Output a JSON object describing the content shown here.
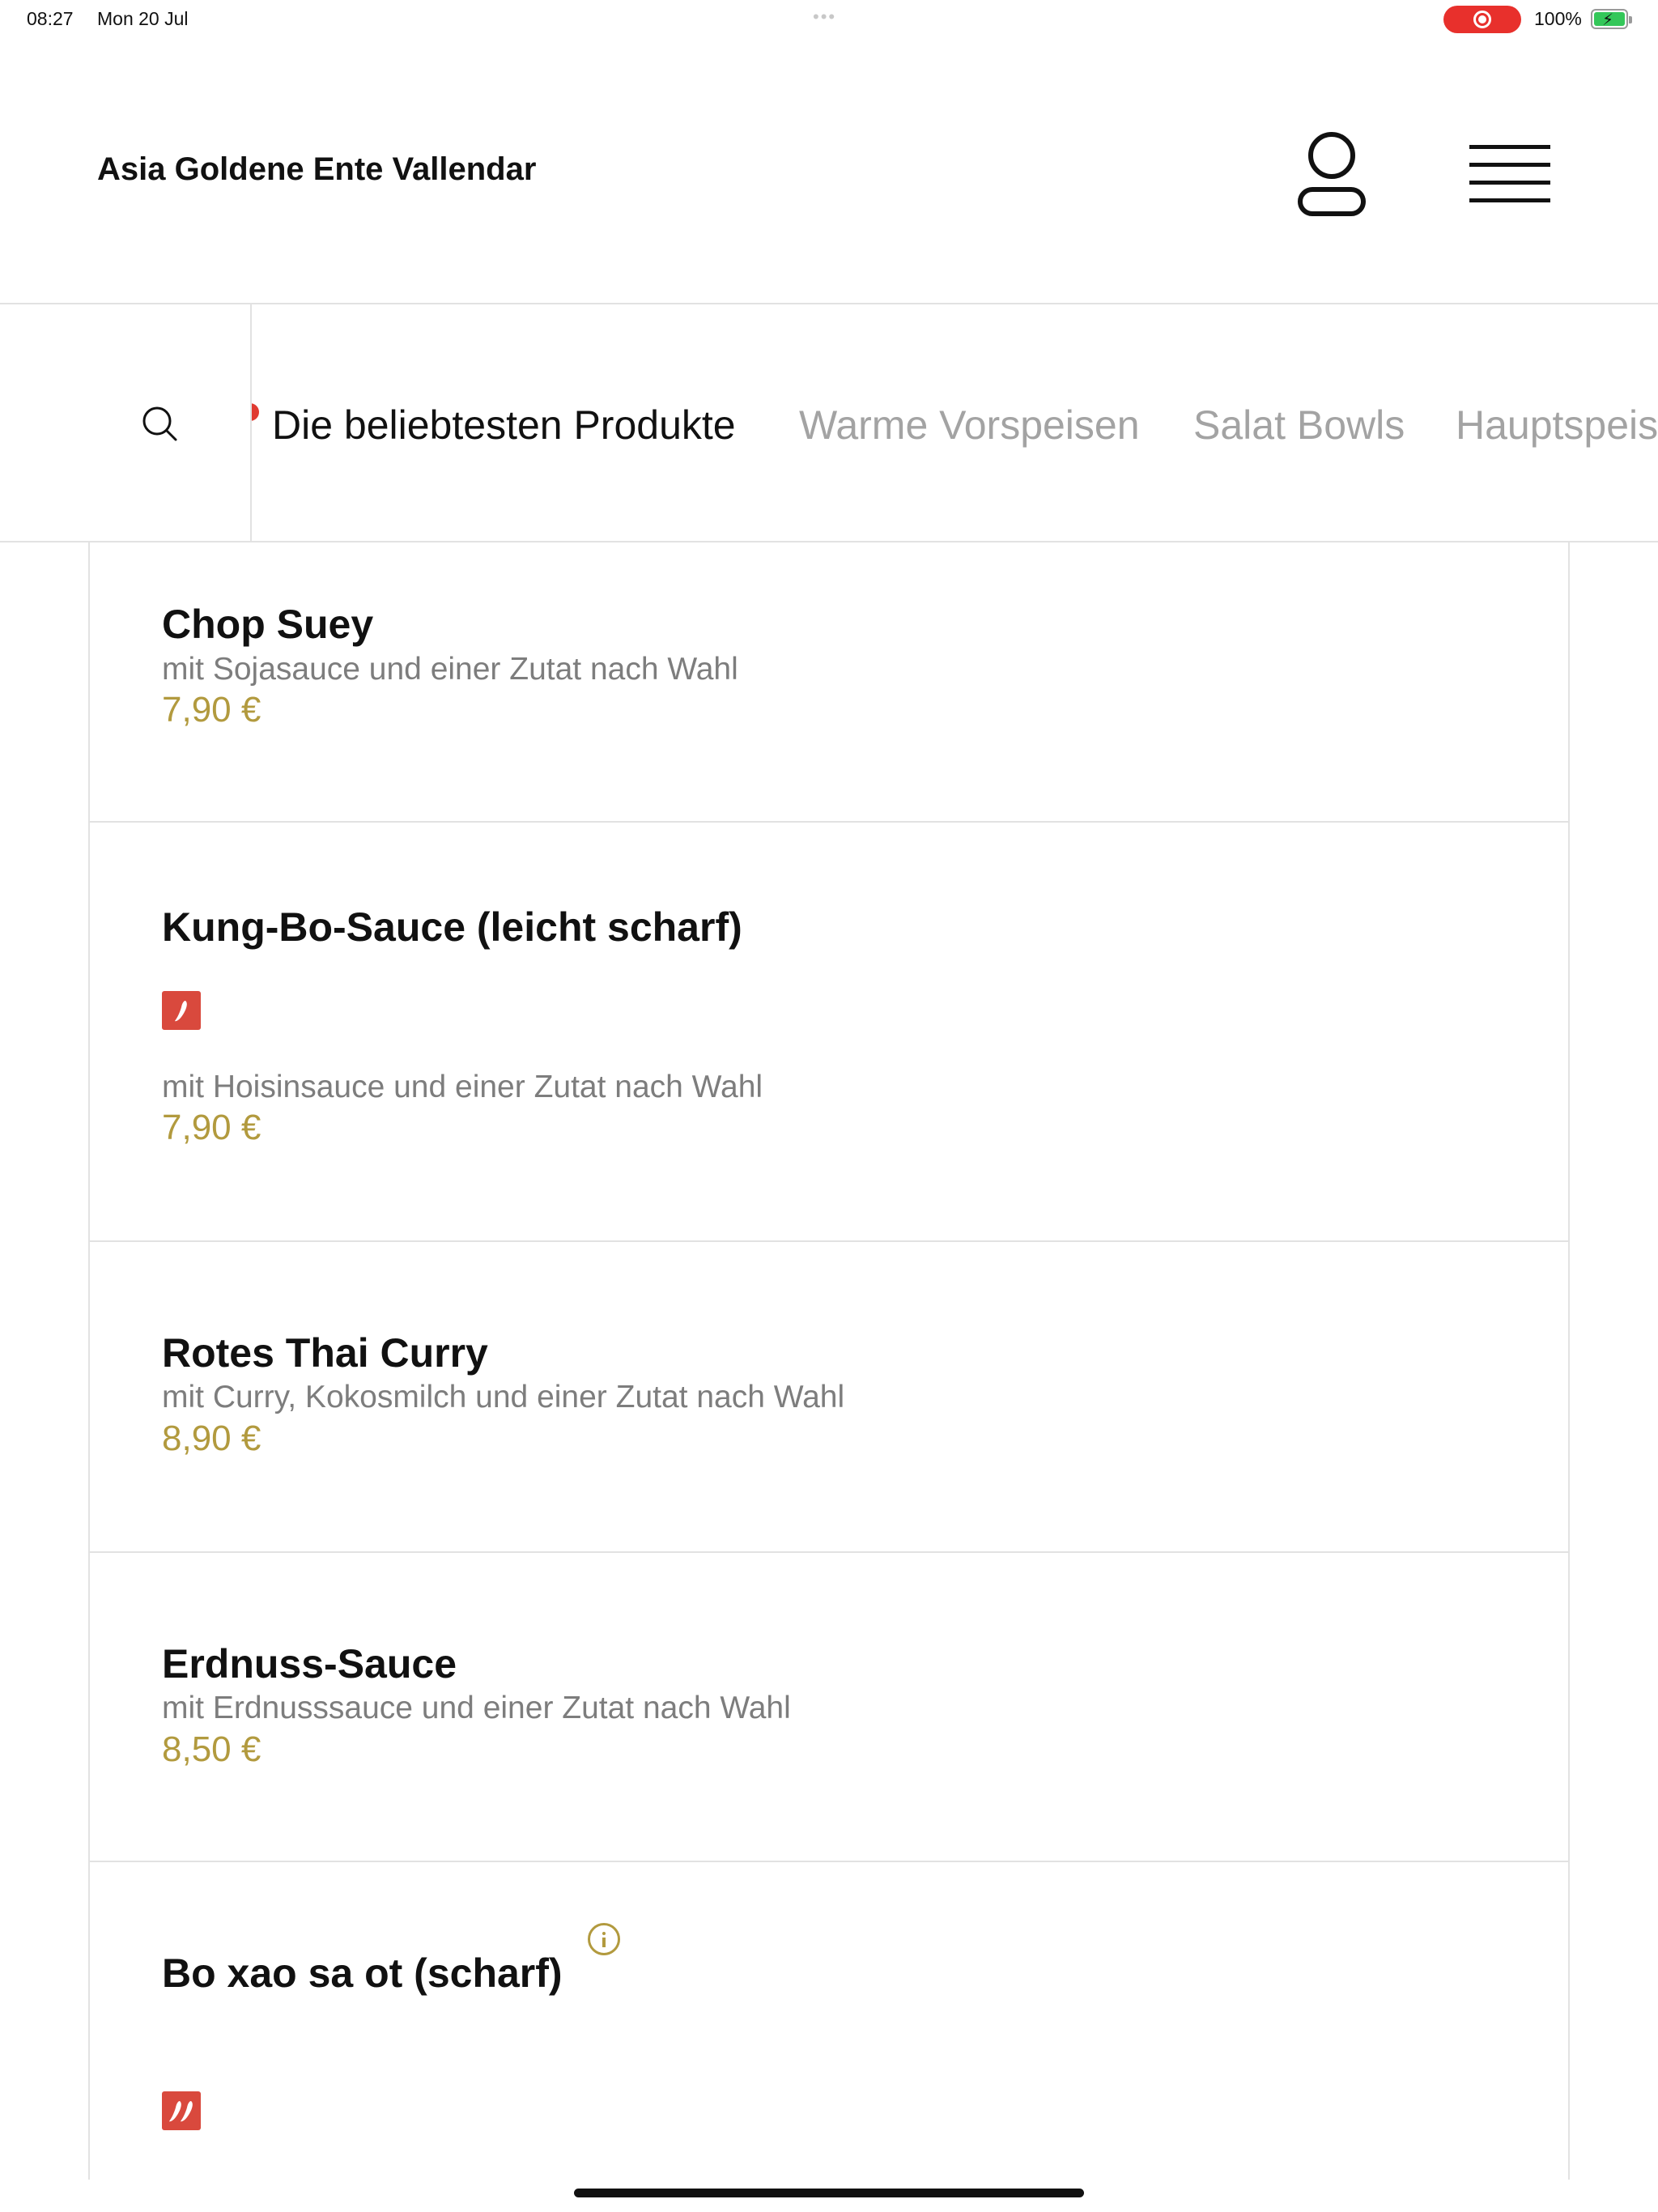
{
  "status_bar": {
    "time": "08:27",
    "date": "Mon 20 Jul",
    "battery_percent": "100%",
    "battery_level": 1.0,
    "recording_active": true
  },
  "header": {
    "restaurant_name": "Asia Goldene Ente Vallendar",
    "account_icon": "user-icon",
    "menu_icon": "hamburger-menu-icon"
  },
  "categories": {
    "search_icon": "search-icon",
    "tabs": [
      {
        "label": "Die beliebtesten Produkte",
        "active": true
      },
      {
        "label": "Warme Vorspeisen",
        "active": false
      },
      {
        "label": "Salat Bowls",
        "active": false
      },
      {
        "label": "Hauptspeis",
        "active": false
      }
    ]
  },
  "products": [
    {
      "name": "Chop Suey",
      "description": "mit Sojasauce und einer Zutat nach Wahl",
      "price": "7,90 €"
    },
    {
      "name": "Kung-Bo-Sauce (leicht scharf)",
      "description": "mit Hoisinsauce und einer Zutat nach Wahl",
      "price": "7,90 €",
      "spice_icon": "chili-icon"
    },
    {
      "name": "Rotes Thai Curry",
      "description": "mit Curry, Kokosmilch und einer Zutat nach Wahl",
      "price": "8,90 €"
    },
    {
      "name": "Erdnuss-Sauce",
      "description": "mit Erdnusssauce und einer Zutat nach Wahl",
      "price": "8,50 €"
    },
    {
      "name": "Bo xao sa ot (scharf)",
      "spice_icon": "double-chili-icon",
      "info_icon": "info-icon"
    }
  ],
  "colors": {
    "price": "#b29a3e",
    "chili_badge": "#d9493d",
    "record_pill": "#e8302c",
    "battery": "#34c759",
    "active_tab": "#111111",
    "inactive_tab": "#a3a3a3"
  }
}
